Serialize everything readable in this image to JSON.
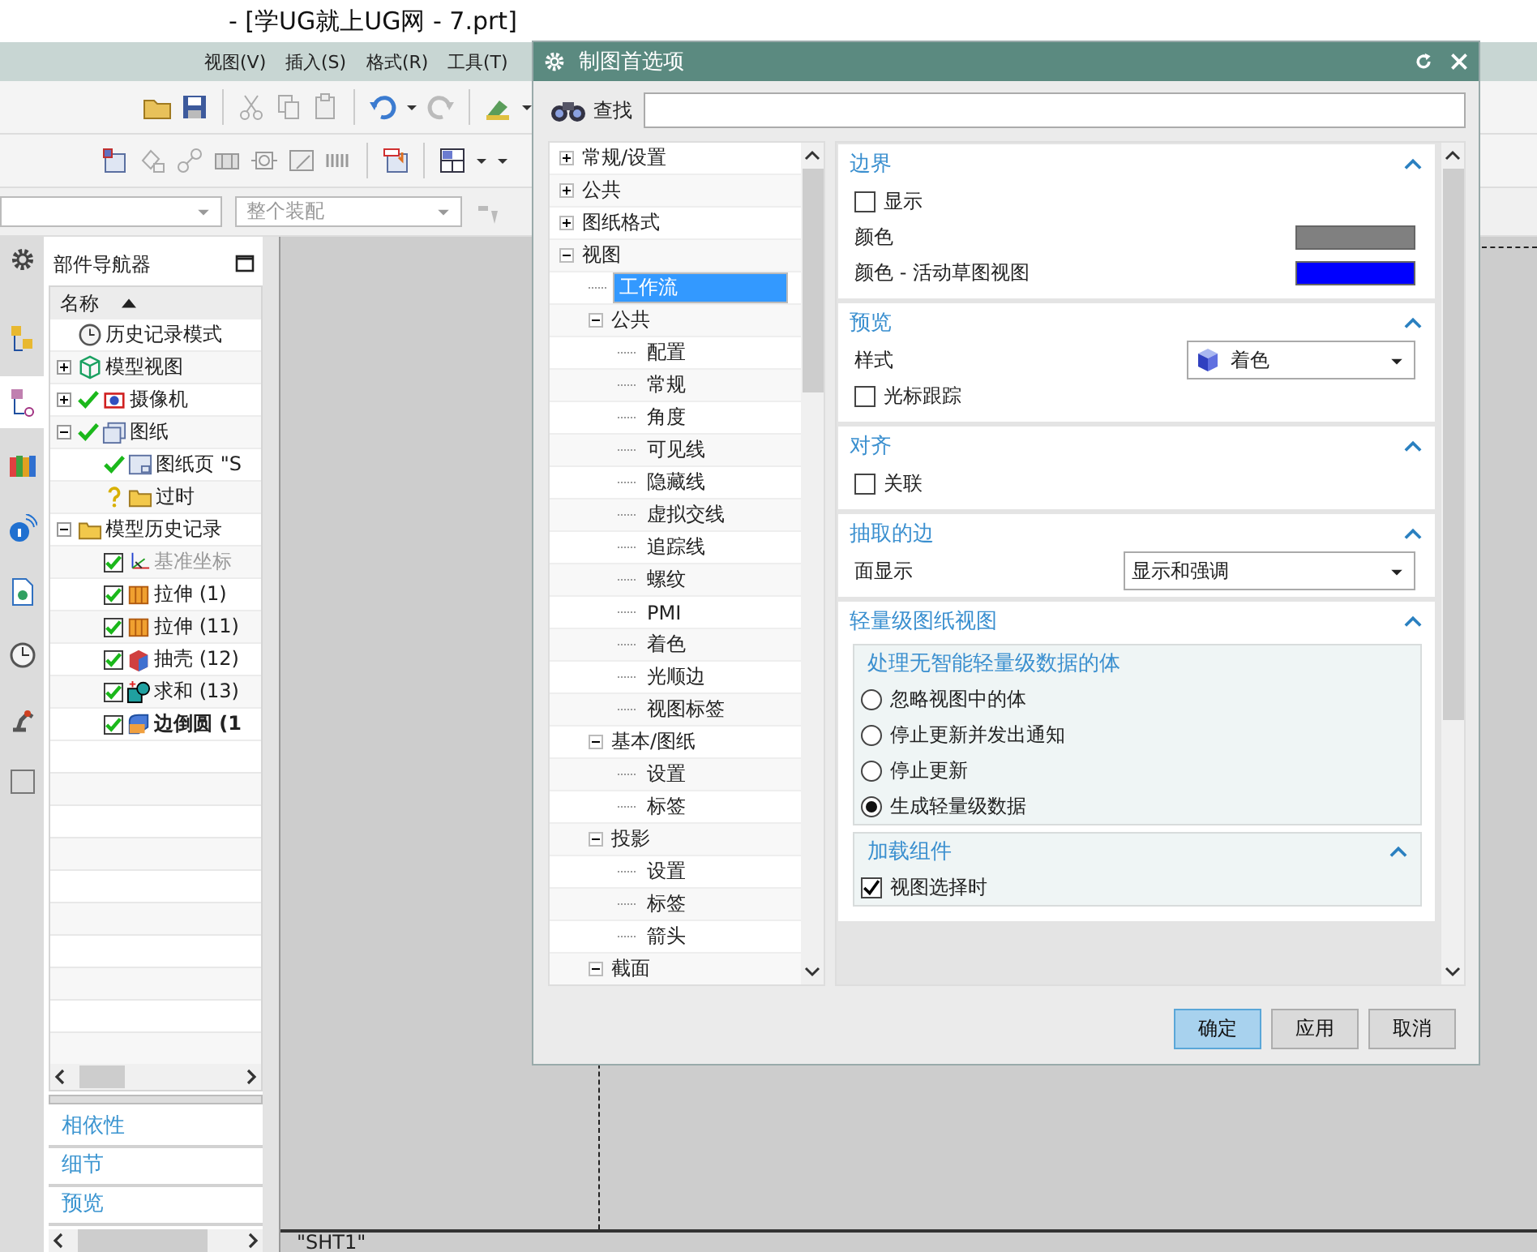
{
  "title_bar": {
    "title": "- [学UG就上UG网 - 7.prt]"
  },
  "menu": [
    "视图(V)",
    "插入(S)",
    "格式(R)",
    "工具(T)"
  ],
  "selection_bar": {
    "scope": {
      "value": "整个装配",
      "disabled": true
    }
  },
  "resource_bar": {
    "tabs": [
      {
        "kind": "assembly",
        "selected": false
      },
      {
        "kind": "part",
        "selected": true
      },
      {
        "kind": "library",
        "selected": false
      },
      {
        "kind": "info",
        "selected": false
      },
      {
        "kind": "web",
        "selected": false
      },
      {
        "kind": "history",
        "selected": false
      },
      {
        "kind": "robot",
        "selected": false
      },
      {
        "kind": "square",
        "selected": false
      }
    ]
  },
  "part_navigator": {
    "title": "部件导航器",
    "column": "名称",
    "tree": [
      {
        "label": "历史记录模式",
        "kind": "clock"
      },
      {
        "label": "模型视图",
        "kind": "views",
        "expanded": false
      },
      {
        "label": "摄像机",
        "kind": "camera",
        "valid": true,
        "expanded": false
      },
      {
        "label": "图纸",
        "kind": "drawing",
        "valid": true,
        "expanded": true,
        "children": [
          {
            "label": "图纸页 \"S",
            "kind": "sheet",
            "valid": true
          },
          {
            "label": "过时",
            "kind": "folder",
            "valid": false
          }
        ]
      },
      {
        "label": "模型历史记录",
        "kind": "folder",
        "expanded": true,
        "children": [
          {
            "label": "基准坐标",
            "kind": "csys",
            "checked": true,
            "dimmed": true,
            "current": false
          },
          {
            "label": "拉伸 (1)",
            "kind": "extrude",
            "checked": true,
            "dimmed": false,
            "current": false
          },
          {
            "label": "拉伸 (11)",
            "kind": "extrude",
            "checked": true,
            "dimmed": false,
            "current": false
          },
          {
            "label": "抽壳 (12)",
            "kind": "shell",
            "checked": true,
            "dimmed": false,
            "current": false
          },
          {
            "label": "求和 (13)",
            "kind": "unite",
            "checked": true,
            "dimmed": false,
            "current": false
          },
          {
            "label": "边倒圆 (1",
            "kind": "blend",
            "checked": true,
            "dimmed": false,
            "current": true
          }
        ]
      }
    ],
    "panels": [
      "相依性",
      "细节",
      "预览"
    ]
  },
  "canvas": {
    "sheet_label": "\"SHT1\""
  },
  "dialog": {
    "title": "制图首选项",
    "search": {
      "label": "查找"
    },
    "tree": [
      {
        "label": "常规/设置",
        "expanded": false,
        "selected": false
      },
      {
        "label": "公共",
        "expanded": false,
        "selected": false
      },
      {
        "label": "图纸格式",
        "expanded": false,
        "selected": false
      },
      {
        "label": "视图",
        "expanded": true,
        "selected": false,
        "children": [
          {
            "label": "工作流",
            "selected": true
          },
          {
            "label": "公共",
            "expanded": true,
            "selected": false,
            "children": [
              {
                "label": "配置",
                "selected": false
              },
              {
                "label": "常规",
                "selected": false
              },
              {
                "label": "角度",
                "selected": false
              },
              {
                "label": "可见线",
                "selected": false
              },
              {
                "label": "隐藏线",
                "selected": false
              },
              {
                "label": "虚拟交线",
                "selected": false
              },
              {
                "label": "追踪线",
                "selected": false
              },
              {
                "label": "螺纹",
                "selected": false
              },
              {
                "label": "PMI",
                "selected": false
              },
              {
                "label": "着色",
                "selected": false
              },
              {
                "label": "光顺边",
                "selected": false
              },
              {
                "label": "视图标签",
                "selected": false
              }
            ]
          },
          {
            "label": "基本/图纸",
            "expanded": true,
            "selected": false,
            "children": [
              {
                "label": "设置",
                "selected": false
              },
              {
                "label": "标签",
                "selected": false
              }
            ]
          },
          {
            "label": "投影",
            "expanded": true,
            "selected": false,
            "children": [
              {
                "label": "设置",
                "selected": false
              },
              {
                "label": "标签",
                "selected": false
              },
              {
                "label": "箭头",
                "selected": false
              }
            ]
          },
          {
            "label": "截面",
            "expanded": true,
            "selected": false
          }
        ]
      }
    ],
    "sections": [
      {
        "title": "边界",
        "expanded": true,
        "rows": [
          {
            "kind": "checkbox",
            "label": "显示",
            "checked": false
          },
          {
            "kind": "color",
            "label": "颜色",
            "color": "#808080"
          },
          {
            "kind": "color",
            "label": "颜色 - 活动草图视图",
            "color": "#0000ff"
          }
        ]
      },
      {
        "title": "预览",
        "expanded": true,
        "rows": [
          {
            "kind": "shaded_select",
            "label": "样式",
            "value": "着色"
          },
          {
            "kind": "checkbox",
            "label": "光标跟踪",
            "checked": false
          }
        ]
      },
      {
        "title": "对齐",
        "expanded": true,
        "rows": [
          {
            "kind": "checkbox",
            "label": "关联",
            "checked": false
          }
        ]
      },
      {
        "title": "抽取的边",
        "expanded": true,
        "rows": [
          {
            "kind": "select",
            "label": "面显示",
            "value": "显示和强调"
          }
        ]
      },
      {
        "title": "轻量级图纸视图",
        "expanded": true,
        "groups": [
          {
            "title": "处理无智能轻量级数据的体",
            "options": [
              {
                "label": "忽略视图中的体",
                "selected": false
              },
              {
                "label": "停止更新并发出通知",
                "selected": false
              },
              {
                "label": "停止更新",
                "selected": false
              },
              {
                "label": "生成轻量级数据",
                "selected": true
              }
            ]
          },
          {
            "title": "加载组件",
            "expanded": true,
            "rows": [
              {
                "kind": "checkbox",
                "label": "视图选择时",
                "checked": true
              }
            ]
          }
        ]
      }
    ],
    "buttons": [
      {
        "label": "确定",
        "default": true
      },
      {
        "label": "应用",
        "default": false
      },
      {
        "label": "取消",
        "default": false
      }
    ]
  }
}
